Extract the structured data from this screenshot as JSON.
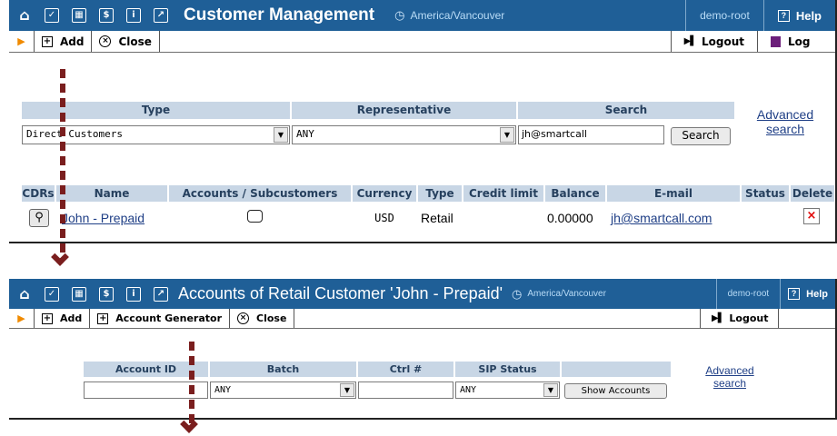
{
  "customer_window": {
    "title": "Customer Management",
    "timezone": "America/Vancouver",
    "user": "demo-root",
    "help_label": "Help",
    "toolbar": {
      "add_label": "Add",
      "close_label": "Close",
      "logout_label": "Logout",
      "log_label": "Log"
    },
    "filters": {
      "type_header": "Type",
      "type_value": "Direct Customers",
      "rep_header": "Representative",
      "rep_value": "ANY",
      "search_header": "Search",
      "search_value": "jh@smartcall",
      "search_button": "Search",
      "advanced_search_1": "Advanced",
      "advanced_search_2": "search"
    },
    "columns": [
      "CDRs",
      "Name",
      "Accounts / Subcustomers",
      "Currency",
      "Type",
      "Credit limit",
      "Balance",
      "E-mail",
      "Status",
      "Delete"
    ],
    "rows": [
      {
        "name": "John - Prepaid",
        "currency": "USD",
        "type": "Retail",
        "credit_limit": "",
        "balance": "0.00000",
        "email": "jh@smartcall.com",
        "status": ""
      }
    ]
  },
  "accounts_window": {
    "title": "Accounts of Retail Customer 'John - Prepaid'",
    "timezone": "America/Vancouver",
    "user": "demo-root",
    "help_label": "Help",
    "toolbar": {
      "add_label": "Add",
      "generator_label": "Account Generator",
      "close_label": "Close",
      "logout_label": "Logout"
    },
    "filters": {
      "account_id_header": "Account ID",
      "account_id_value": "",
      "batch_header": "Batch",
      "batch_value": "ANY",
      "ctrl_header": "Ctrl #",
      "ctrl_value": "",
      "sip_header": "SIP Status",
      "sip_value": "ANY",
      "show_button": "Show Accounts",
      "advanced_search_1": "Advanced",
      "advanced_search_2": "search"
    }
  },
  "colors": {
    "titlebar": "#1f5f97",
    "header_cell": "#c8d6e5",
    "arrow": "#7a1e1e",
    "link": "#1f3f86"
  }
}
